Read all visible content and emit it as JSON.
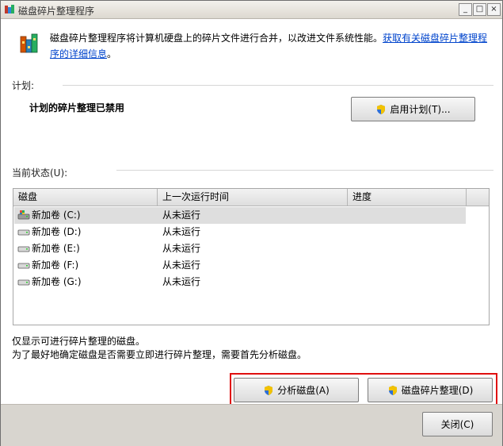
{
  "window": {
    "title": "磁盘碎片整理程序",
    "controls": {
      "minimize": "_",
      "maximize": "□",
      "close": "×"
    }
  },
  "description": {
    "text": "磁盘碎片整理程序将计算机硬盘上的碎片文件进行合并，以改进文件系统性能。",
    "link": "获取有关磁盘碎片整理程序的详细信息",
    "suffix": "。"
  },
  "schedule": {
    "label": "计划:",
    "status": "计划的碎片整理已禁用",
    "enable_button": "启用计划(T)..."
  },
  "current_status": {
    "label": "当前状态(U):",
    "columns": [
      "磁盘",
      "上一次运行时间",
      "进度"
    ],
    "rows": [
      {
        "disk": "新加卷 (C:)",
        "last_run": "从未运行",
        "progress": "",
        "icon": "system-drive-icon",
        "selected": true
      },
      {
        "disk": "新加卷 (D:)",
        "last_run": "从未运行",
        "progress": "",
        "icon": "drive-icon"
      },
      {
        "disk": "新加卷 (E:)",
        "last_run": "从未运行",
        "progress": "",
        "icon": "drive-icon"
      },
      {
        "disk": "新加卷 (F:)",
        "last_run": "从未运行",
        "progress": "",
        "icon": "drive-icon"
      },
      {
        "disk": "新加卷 (G:)",
        "last_run": "从未运行",
        "progress": "",
        "icon": "drive-icon"
      }
    ]
  },
  "info": {
    "line1": "仅显示可进行碎片整理的磁盘。",
    "line2": "为了最好地确定磁盘是否需要立即进行碎片整理，需要首先分析磁盘。"
  },
  "actions": {
    "analyze": "分析磁盘(A)",
    "defragment": "磁盘碎片整理(D)",
    "close": "关闭(C)"
  },
  "colors": {
    "highlight_border": "#e01010",
    "link": "#0044cc",
    "selected_row": "#dedede"
  }
}
